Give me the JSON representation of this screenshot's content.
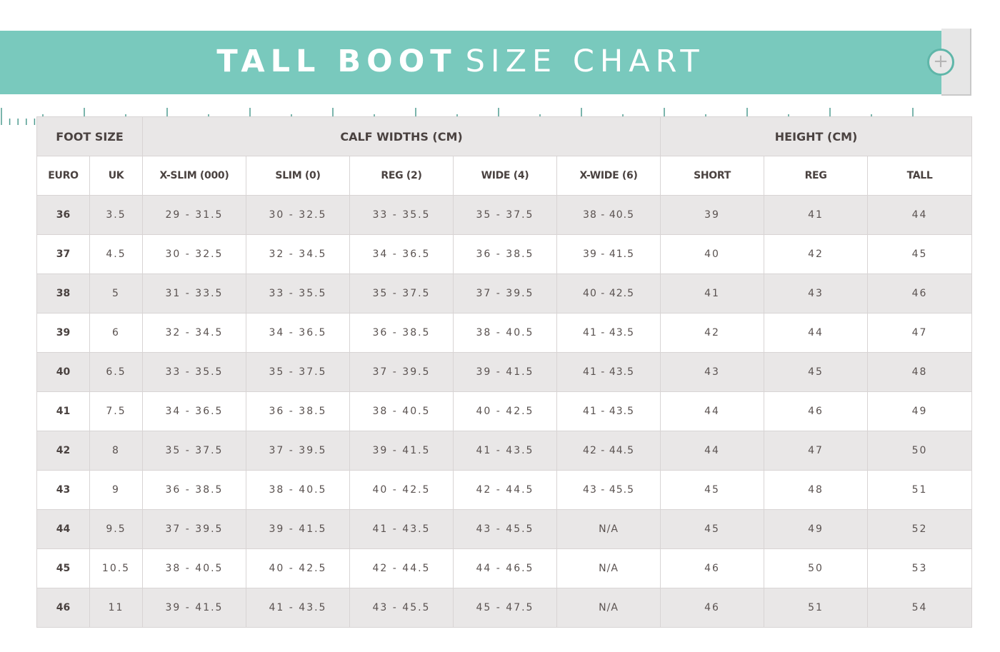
{
  "banner": {
    "title_bold": "TALL BOOT",
    "title_light": "SIZE CHART",
    "background_color": "#79c9bd",
    "knob_icon": "plus-icon"
  },
  "table": {
    "group_headers": {
      "foot_size": "FOOT SIZE",
      "calf_widths": "CALF WIDTHS (CM)",
      "height": "HEIGHT (CM)"
    },
    "columns": [
      "EURO",
      "UK",
      "X-SLIM (000)",
      "SLIM (0)",
      "REG (2)",
      "WIDE (4)",
      "X-WIDE (6)",
      "SHORT",
      "REG",
      "TALL"
    ],
    "rows": [
      [
        "36",
        "3.5",
        "29 - 31.5",
        "30 - 32.5",
        "33 - 35.5",
        "35 - 37.5",
        "38 - 40.5",
        "39",
        "41",
        "44"
      ],
      [
        "37",
        "4.5",
        "30 - 32.5",
        "32 - 34.5",
        "34 - 36.5",
        "36 - 38.5",
        "39 - 41.5",
        "40",
        "42",
        "45"
      ],
      [
        "38",
        "5",
        "31 - 33.5",
        "33 - 35.5",
        "35 - 37.5",
        "37 - 39.5",
        "40 - 42.5",
        "41",
        "43",
        "46"
      ],
      [
        "39",
        "6",
        "32 - 34.5",
        "34 - 36.5",
        "36 - 38.5",
        "38 - 40.5",
        "41 - 43.5",
        "42",
        "44",
        "47"
      ],
      [
        "40",
        "6.5",
        "33 - 35.5",
        "35 - 37.5",
        "37 - 39.5",
        "39 - 41.5",
        "41 - 43.5",
        "43",
        "45",
        "48"
      ],
      [
        "41",
        "7.5",
        "34 - 36.5",
        "36 - 38.5",
        "38 - 40.5",
        "40 - 42.5",
        "41 - 43.5",
        "44",
        "46",
        "49"
      ],
      [
        "42",
        "8",
        "35 - 37.5",
        "37 - 39.5",
        "39 - 41.5",
        "41 - 43.5",
        "42 - 44.5",
        "44",
        "47",
        "50"
      ],
      [
        "43",
        "9",
        "36 - 38.5",
        "38 - 40.5",
        "40 - 42.5",
        "42 - 44.5",
        "43 - 45.5",
        "45",
        "48",
        "51"
      ],
      [
        "44",
        "9.5",
        "37 - 39.5",
        "39 - 41.5",
        "41 - 43.5",
        "43 - 45.5",
        "N/A",
        "45",
        "49",
        "52"
      ],
      [
        "45",
        "10.5",
        "38 - 40.5",
        "40 - 42.5",
        "42 - 44.5",
        "44 - 46.5",
        "N/A",
        "46",
        "50",
        "53"
      ],
      [
        "46",
        "11",
        "39 - 41.5",
        "41 - 43.5",
        "43 - 45.5",
        "45 - 47.5",
        "N/A",
        "46",
        "51",
        "54"
      ]
    ]
  }
}
